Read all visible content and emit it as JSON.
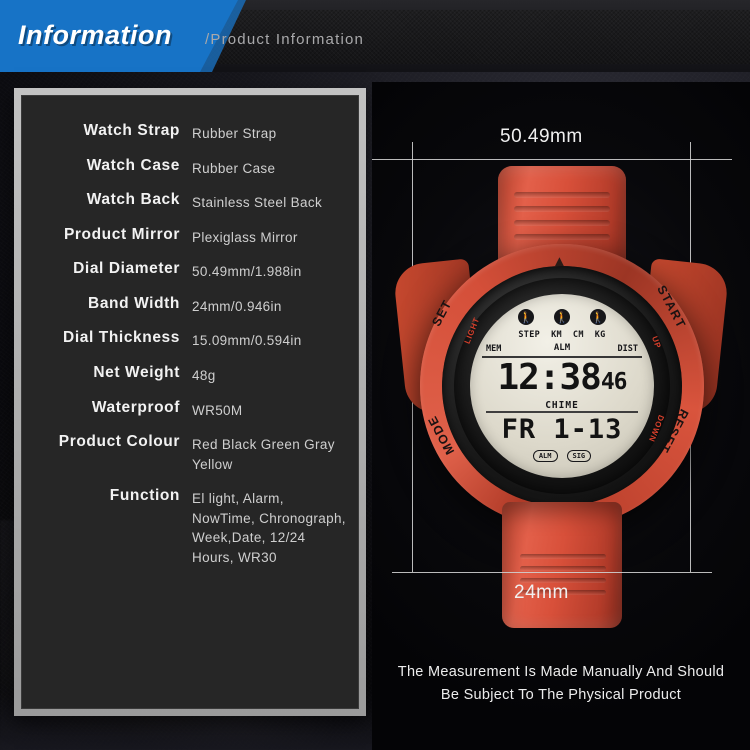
{
  "header": {
    "banner_title": "Information",
    "subtitle": "/Product Information",
    "accent_color": "#1773c6"
  },
  "spec_panel": {
    "rows": [
      {
        "label": "Watch Strap",
        "value": "Rubber Strap"
      },
      {
        "label": "Watch Case",
        "value": "Rubber Case"
      },
      {
        "label": "Watch Back",
        "value": "Stainless Steel Back"
      },
      {
        "label": "Product Mirror",
        "value": "Plexiglass Mirror"
      },
      {
        "label": "Dial Diameter",
        "value": "50.49mm/1.988in"
      },
      {
        "label": "Band Width",
        "value": "24mm/0.946in"
      },
      {
        "label": "Dial Thickness",
        "value": "15.09mm/0.594in"
      },
      {
        "label": "Net Weight",
        "value": "48g"
      },
      {
        "label": "Waterproof",
        "value": "WR50M"
      },
      {
        "label": "Product Colour",
        "value": "Red Black Green Gray Yellow"
      },
      {
        "label": "Function",
        "value": "El light, Alarm, NowTime, Chronograph, Week,Date, 12/24 Hours, WR30"
      }
    ]
  },
  "product": {
    "dimension_width": "50.49mm",
    "dimension_band": "24mm",
    "caption_line1": "The Measurement Is Made Manually And Should",
    "caption_line2": "Be Subject To The Physical Product",
    "strap_color": "#d8503a",
    "watch": {
      "bezel_set": "SET",
      "bezel_mode": "MODE",
      "bezel_start": "START",
      "bezel_reset": "RESET",
      "inner_light": "LIGHT",
      "inner_up": "UP",
      "inner_down": "DOWN",
      "lcd": {
        "units": [
          "STEP",
          "KM",
          "CM",
          "KG"
        ],
        "mem": "MEM",
        "dist": "DIST",
        "alarm_top": "ALM",
        "time": "12:38",
        "seconds": "46",
        "chime": "CHIME",
        "date": "FR 1-13",
        "pill_alarm": "ALM",
        "pill_signal": "SIG",
        "runner_glyph": "\u0001"
      }
    }
  }
}
